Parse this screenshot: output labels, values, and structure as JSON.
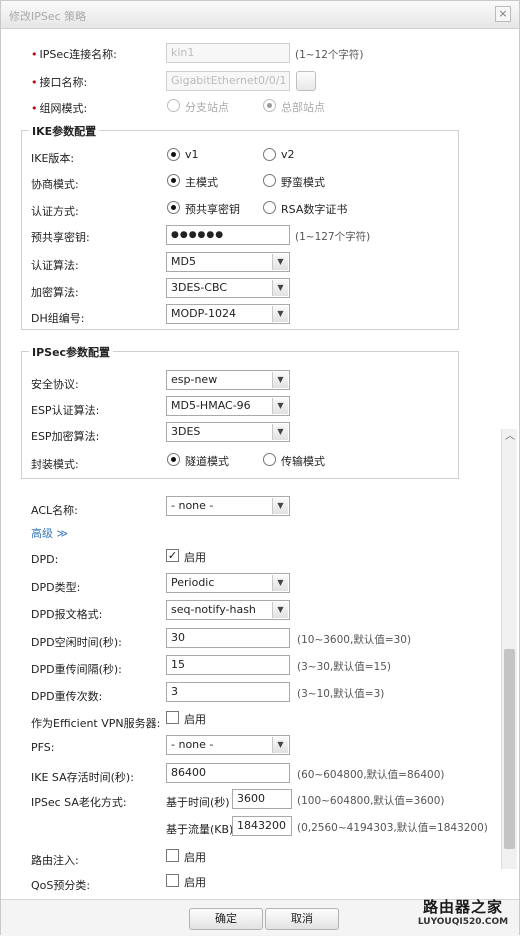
{
  "dialog": {
    "title": "修改IPSec 策略",
    "close_glyph": "×"
  },
  "general": {
    "conn_name": {
      "label": "IPSec连接名称:",
      "value": "kin1",
      "hint": "(1~12个字符)"
    },
    "interface": {
      "label": "接口名称:",
      "value": "GigabitEthernet0/0/1"
    },
    "network_mode": {
      "label": "组网模式:",
      "options": [
        "分支站点",
        "总部站点"
      ],
      "selected": "总部站点"
    }
  },
  "ike": {
    "title": "IKE参数配置",
    "version": {
      "label": "IKE版本:",
      "options": [
        "v1",
        "v2"
      ],
      "selected": "v1"
    },
    "negotiation": {
      "label": "协商模式:",
      "options": [
        "主模式",
        "野蛮模式"
      ],
      "selected": "主模式"
    },
    "auth_method": {
      "label": "认证方式:",
      "options": [
        "预共享密钥",
        "RSA数字证书"
      ],
      "selected": "预共享密钥"
    },
    "psk": {
      "label": "预共享密钥:",
      "value": "●●●●●●",
      "hint": "(1~127个字符)"
    },
    "auth_alg": {
      "label": "认证算法:",
      "value": "MD5"
    },
    "enc_alg": {
      "label": "加密算法:",
      "value": "3DES-CBC"
    },
    "dh_group": {
      "label": "DH组编号:",
      "value": "MODP-1024"
    }
  },
  "ipsec": {
    "title": "IPSec参数配置",
    "protocol": {
      "label": "安全协议:",
      "value": "esp-new"
    },
    "esp_auth": {
      "label": "ESP认证算法:",
      "value": "MD5-HMAC-96"
    },
    "esp_enc": {
      "label": "ESP加密算法:",
      "value": "3DES"
    },
    "encap": {
      "label": "封装模式:",
      "options": [
        "隧道模式",
        "传输模式"
      ],
      "selected": "隧道模式"
    }
  },
  "acl": {
    "label": "ACL名称:",
    "value": "- none -"
  },
  "advanced": {
    "label": "高级 ≫"
  },
  "dpd": {
    "enable": {
      "label": "DPD:",
      "check_label": "启用",
      "checked": true
    },
    "type": {
      "label": "DPD类型:",
      "value": "Periodic"
    },
    "format": {
      "label": "DPD报文格式:",
      "value": "seq-notify-hash"
    },
    "idle": {
      "label": "DPD空闲时间(秒):",
      "value": "30",
      "hint": "(10~3600,默认值=30)"
    },
    "interval": {
      "label": "DPD重传间隔(秒):",
      "value": "15",
      "hint": "(3~30,默认值=15)"
    },
    "retries": {
      "label": "DPD重传次数:",
      "value": "3",
      "hint": "(3~10,默认值=3)"
    }
  },
  "vpn_server": {
    "label": "作为Efficient VPN服务器:",
    "check_label": "启用",
    "checked": false
  },
  "pfs": {
    "label": "PFS:",
    "value": "- none -"
  },
  "ike_sa": {
    "label": "IKE SA存活时间(秒):",
    "value": "86400",
    "hint": "(60~604800,默认值=86400)"
  },
  "ipsec_sa": {
    "label": "IPSec SA老化方式:",
    "time_label": "基于时间(秒)",
    "time_value": "3600",
    "time_hint": "(100~604800,默认值=3600)",
    "traffic_label": "基于流量(KB)",
    "traffic_value": "1843200",
    "traffic_hint": "(0,2560~4194303,默认值=1843200)"
  },
  "route_inject": {
    "label": "路由注入:",
    "check_label": "启用",
    "checked": false
  },
  "qos": {
    "label": "QoS预分类:",
    "check_label": "启用",
    "checked": false
  },
  "buttons": {
    "ok": "确定",
    "cancel": "取消"
  },
  "watermark": {
    "brand": "路由器之家",
    "url": "LUYOUQI520.COM"
  },
  "icons": {
    "dropdown": "▼",
    "scroll_up": "︿",
    "checkmark": "✓"
  }
}
